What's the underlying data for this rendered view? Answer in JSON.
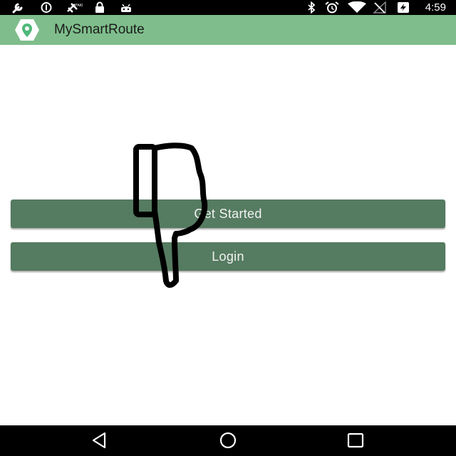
{
  "status_bar": {
    "time": "4:59",
    "left_icons": [
      "wrench-icon",
      "data-saver-icon",
      "satellite-icon",
      "lock-icon",
      "android-icon"
    ],
    "right_icons": [
      "bluetooth-icon",
      "alarm-icon",
      "wifi-icon",
      "no-signal-icon",
      "battery-charging-icon"
    ]
  },
  "app_bar": {
    "title": "MySmartRoute",
    "logo_icon": "location-pin-icon",
    "background": "#7fbe8c"
  },
  "main": {
    "get_started_label": "Get Started",
    "login_label": "Login",
    "button_color": "#557b60",
    "overlay_icon": "thumbs-down-icon"
  },
  "nav_bar": {
    "buttons": [
      "back-icon",
      "home-icon",
      "recents-icon"
    ]
  }
}
